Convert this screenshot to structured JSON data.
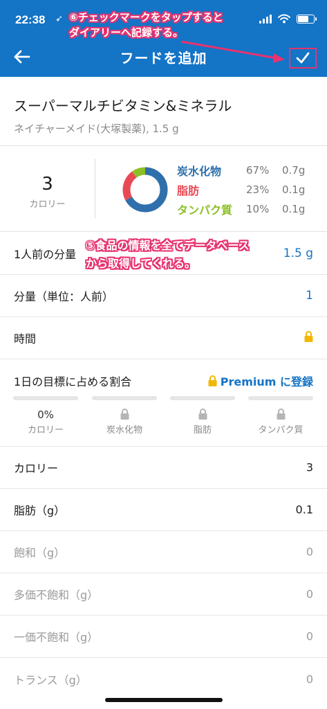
{
  "status": {
    "time": "22:38",
    "location_glyph": "➶"
  },
  "header": {
    "title": "フードを追加"
  },
  "annotations": {
    "top_line1": "⑥チェックマークをタップすると",
    "top_line2": "ダイアリーへ記録する。",
    "mid_line1": "⑤食品の情報を全てデータベース",
    "mid_line2": "から取得してくれる。"
  },
  "food": {
    "name": "スーパーマルチビタミン&ミネラル",
    "brand_serving": "ネイチャーメイド(大塚製薬), 1.5 g"
  },
  "summary": {
    "calories": "3",
    "calories_label": "カロリー",
    "macros": [
      {
        "name": "炭水化物",
        "percent": "67%",
        "grams": "0.7g",
        "share": 67,
        "color": "#2f6fab"
      },
      {
        "name": "脂肪",
        "percent": "23%",
        "grams": "0.1g",
        "share": 23,
        "color": "#e84a55"
      },
      {
        "name": "タンパク質",
        "percent": "10%",
        "grams": "0.1g",
        "share": 10,
        "color": "#8cbf26"
      }
    ]
  },
  "fields": {
    "servings_label": "1人前の分量",
    "servings_value": "1.5 g",
    "qty_label": "分量（単位：人前）",
    "qty_value": "1",
    "time_label": "時間"
  },
  "goal": {
    "label": "1日の目標に占める割合",
    "premium_link": "Premium に登録",
    "items": [
      {
        "value": "0%",
        "name": "カロリー"
      },
      {
        "name": "炭水化物"
      },
      {
        "name": "脂肪"
      },
      {
        "name": "タンパク質"
      }
    ]
  },
  "nutrients": [
    {
      "label": "カロリー",
      "value": "3"
    },
    {
      "label": "脂肪（g）",
      "value": "0.1"
    },
    {
      "label": "飽和（g）",
      "value": "0"
    },
    {
      "label": "多価不飽和（g）",
      "value": "0"
    },
    {
      "label": "一価不飽和（g）",
      "value": "0"
    },
    {
      "label": "トランス（g）",
      "value": "0"
    }
  ],
  "colors": {
    "header": "#1474c6",
    "accent": "#1474c6",
    "annotation": "#e8336f",
    "lock": "#f2b705"
  }
}
